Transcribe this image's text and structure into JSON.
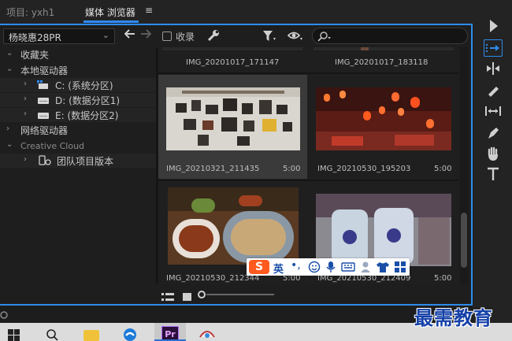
{
  "tabs": {
    "project": "项目: yxh1",
    "media_browser": "媒体 浏览器",
    "menu": "≡"
  },
  "toolbar": {
    "drive": "杨晓惠28PR",
    "favorite_label": "收录"
  },
  "tree": {
    "favorites": "收藏夹",
    "local_drives": "本地驱动器",
    "drive_c": "C: (系统分区)",
    "drive_d": "D: (数据分区1)",
    "drive_e": "E: (数据分区2)",
    "network_drives": "网络驱动器",
    "creative_cloud": "Creative Cloud",
    "team_projects": "团队项目版本"
  },
  "clips": [
    {
      "name": "IMG_20201017_171147",
      "duration": ""
    },
    {
      "name": "IMG_20201017_183118",
      "duration": ""
    },
    {
      "name": "IMG_20210321_211435",
      "duration": "5:00"
    },
    {
      "name": "IMG_20210530_195203",
      "duration": "5:00"
    },
    {
      "name": "IMG_20210530_212344",
      "duration": "5:00"
    },
    {
      "name": "IMG_20210530_212409",
      "duration": "5:00"
    }
  ],
  "ime": {
    "logo": "S",
    "mode": "英",
    "punct": "•,"
  },
  "taskbar": {
    "premiere": "Pr"
  },
  "watermark": "最需教育",
  "colors": {
    "accent": "#2d8ceb",
    "panel_bg": "#1e1e1e",
    "selected_cell": "#3a3a3a"
  }
}
